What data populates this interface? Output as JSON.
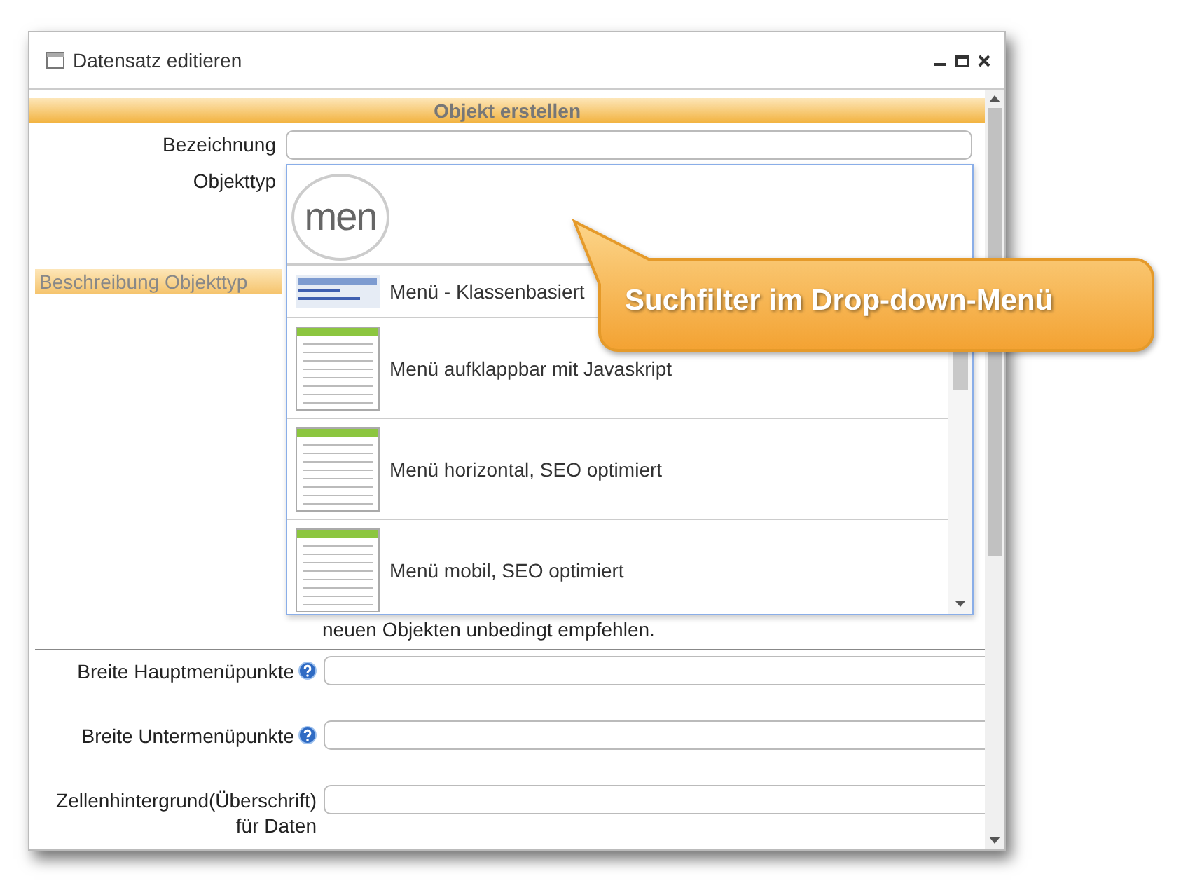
{
  "window": {
    "title": "Datensatz editieren"
  },
  "section_header": "Objekt erstellen",
  "top_fields": [
    {
      "label": "Bezeichnung",
      "kind": "text"
    },
    {
      "label": "Objekttyp",
      "kind": "select"
    }
  ],
  "description": {
    "label": "Beschreibung Objekttyp",
    "text": "neuen Objekten unbedingt empfehlen."
  },
  "fields": [
    {
      "label": "Breite Hauptmenüpunkte",
      "help": true
    },
    {
      "label": "Breite Untermenüpunkte",
      "help": true
    },
    {
      "label": "Zellenhintergrund(Überschrift) für Daten",
      "help": false
    }
  ],
  "dropdown": {
    "search_value": "men",
    "options": [
      {
        "label": "Menü - Klassenbasiert",
        "kind": "breadcrumb"
      },
      {
        "label": "Menü aufklappbar mit Javaskript",
        "kind": "list"
      },
      {
        "label": "Menü horizontal, SEO optimiert",
        "kind": "list"
      },
      {
        "label": "Menü mobil, SEO optimiert",
        "kind": "list"
      }
    ]
  },
  "callout": {
    "text": "Suchfilter im Drop-down-Menü"
  }
}
